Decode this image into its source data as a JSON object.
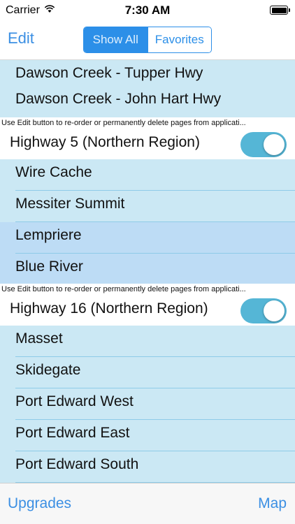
{
  "status_bar": {
    "carrier": "Carrier",
    "time": "7:30 AM"
  },
  "nav": {
    "edit_label": "Edit",
    "segments": [
      {
        "label": "Show All",
        "selected": true
      },
      {
        "label": "Favorites",
        "selected": false
      }
    ]
  },
  "list": {
    "top_rows": [
      {
        "label": "Dawson Creek - Tupper Hwy"
      },
      {
        "label": "Dawson Creek - John Hart Hwy"
      }
    ],
    "sections": [
      {
        "hint": "Use Edit button to re-order or permanently delete pages from applicati...",
        "title": "Highway 5 (Northern Region)",
        "toggle_on": true,
        "rows": [
          {
            "label": "Wire Cache",
            "highlighted": false
          },
          {
            "label": "Messiter Summit",
            "highlighted": false
          },
          {
            "label": "Lempriere",
            "highlighted": true
          },
          {
            "label": "Blue River",
            "highlighted": true
          }
        ]
      },
      {
        "hint": "Use Edit button to re-order or permanently delete pages from applicati...",
        "title": "Highway 16 (Northern  Region)",
        "toggle_on": true,
        "rows": [
          {
            "label": "Masset",
            "highlighted": false
          },
          {
            "label": "Skidegate",
            "highlighted": false
          },
          {
            "label": "Port Edward West",
            "highlighted": false
          },
          {
            "label": "Port Edward East",
            "highlighted": false
          },
          {
            "label": "Port Edward South",
            "highlighted": false
          }
        ]
      }
    ]
  },
  "tab_bar": {
    "upgrades_label": "Upgrades",
    "map_label": "Map"
  },
  "colors": {
    "accent": "#2c8fe8",
    "row_background": "#cbe8f4",
    "row_highlight": "#bddcf5",
    "toggle_on": "#55b6d6"
  }
}
